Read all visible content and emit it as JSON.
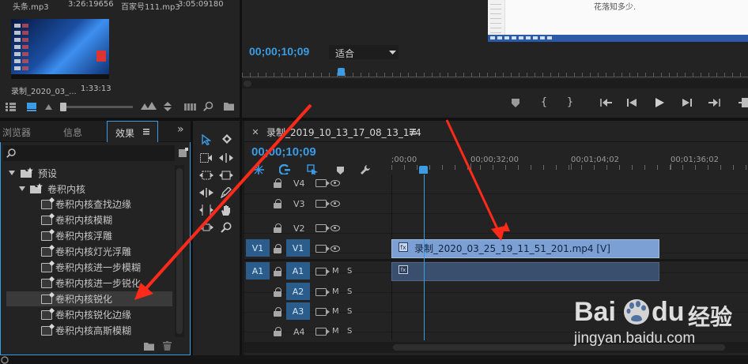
{
  "project": {
    "clips": [
      {
        "name": "头条.mp3",
        "duration": "3:26:19656"
      },
      {
        "name": "百家号111.mp3",
        "duration": "3:05:09180"
      },
      {
        "name": "录制_2020_03_...",
        "duration": "1:33:13"
      }
    ]
  },
  "program": {
    "timecode": "00;00;10;09",
    "fit_label": "适合",
    "preview_text": "花落知多少."
  },
  "left_tabs": {
    "browser": "浏览器",
    "info": "信息",
    "effects": "效果",
    "more": "»"
  },
  "effects": {
    "search_placeholder": "",
    "tree": [
      {
        "label": "预设",
        "level": 0
      },
      {
        "label": "卷积内核",
        "level": 1
      },
      {
        "label": "卷积内核查找边缘",
        "level": 2
      },
      {
        "label": "卷积内核模糊",
        "level": 2
      },
      {
        "label": "卷积内核浮雕",
        "level": 2
      },
      {
        "label": "卷积内核灯光浮雕",
        "level": 2
      },
      {
        "label": "卷积内核进一步模糊",
        "level": 2
      },
      {
        "label": "卷积内核进一步锐化",
        "level": 2
      },
      {
        "label": "卷积内核锐化",
        "level": 2,
        "selected": true
      },
      {
        "label": "卷积内核锐化边缘",
        "level": 2
      },
      {
        "label": "卷积内核高斯模糊",
        "level": 2
      }
    ]
  },
  "timeline": {
    "sequence_name": "录制_2019_10_13_17_08_13_174",
    "timecode": "00;00;10;09",
    "ruler": [
      ";00;00",
      "00;00;32;00",
      "00;01;04;02",
      "00;01;36;02"
    ],
    "tracks": [
      {
        "name": "V4",
        "src": ""
      },
      {
        "name": "V3",
        "src": ""
      },
      {
        "name": "V2",
        "src": ""
      },
      {
        "name": "V1",
        "src": "V1"
      },
      {
        "name": "A1",
        "src": "A1"
      },
      {
        "name": "A2",
        "src": ""
      },
      {
        "name": "A3",
        "src": ""
      },
      {
        "name": "A4",
        "src": ""
      }
    ],
    "mute": "M",
    "solo": "S",
    "video_clip": "录制_2020_03_25_19_11_51_201.mp4 [V]",
    "fx_badge": "fx"
  },
  "watermark": {
    "brand_a": "Bai",
    "brand_b": "du",
    "brand_cn": "经验",
    "url": "jingyan.baidu.com"
  },
  "colors": {
    "accent": "#2d8ceb",
    "clip_video": "#7ca0d4",
    "clip_audio": "#3a4f6d",
    "work_area": "#e3cf1f",
    "arrow": "#ff2a1a"
  }
}
